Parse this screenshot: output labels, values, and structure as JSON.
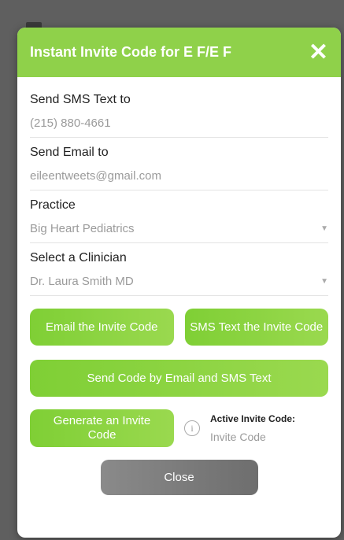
{
  "modal": {
    "title": "Instant Invite Code for E F/E F",
    "close_glyph": "✕"
  },
  "fields": {
    "sms": {
      "label": "Send SMS Text to",
      "value": "(215) 880-4661"
    },
    "email": {
      "label": "Send Email to",
      "value": "eileentweets@gmail.com"
    },
    "practice": {
      "label": "Practice",
      "value": "Big Heart Pediatrics"
    },
    "clinician": {
      "label": "Select a Clinician",
      "value": "Dr. Laura Smith MD"
    }
  },
  "buttons": {
    "email_invite": "Email the Invite Code",
    "sms_invite": "SMS Text the Invite Code",
    "send_both": "Send Code by Email and SMS Text",
    "generate": "Generate an Invite Code",
    "close": "Close"
  },
  "active_code": {
    "label": "Active Invite Code:",
    "value": "Invite Code"
  },
  "icons": {
    "dropdown": "▼",
    "info": "i"
  },
  "colors": {
    "accent": "#8fd14a",
    "close_button": "#7a7a7a"
  }
}
